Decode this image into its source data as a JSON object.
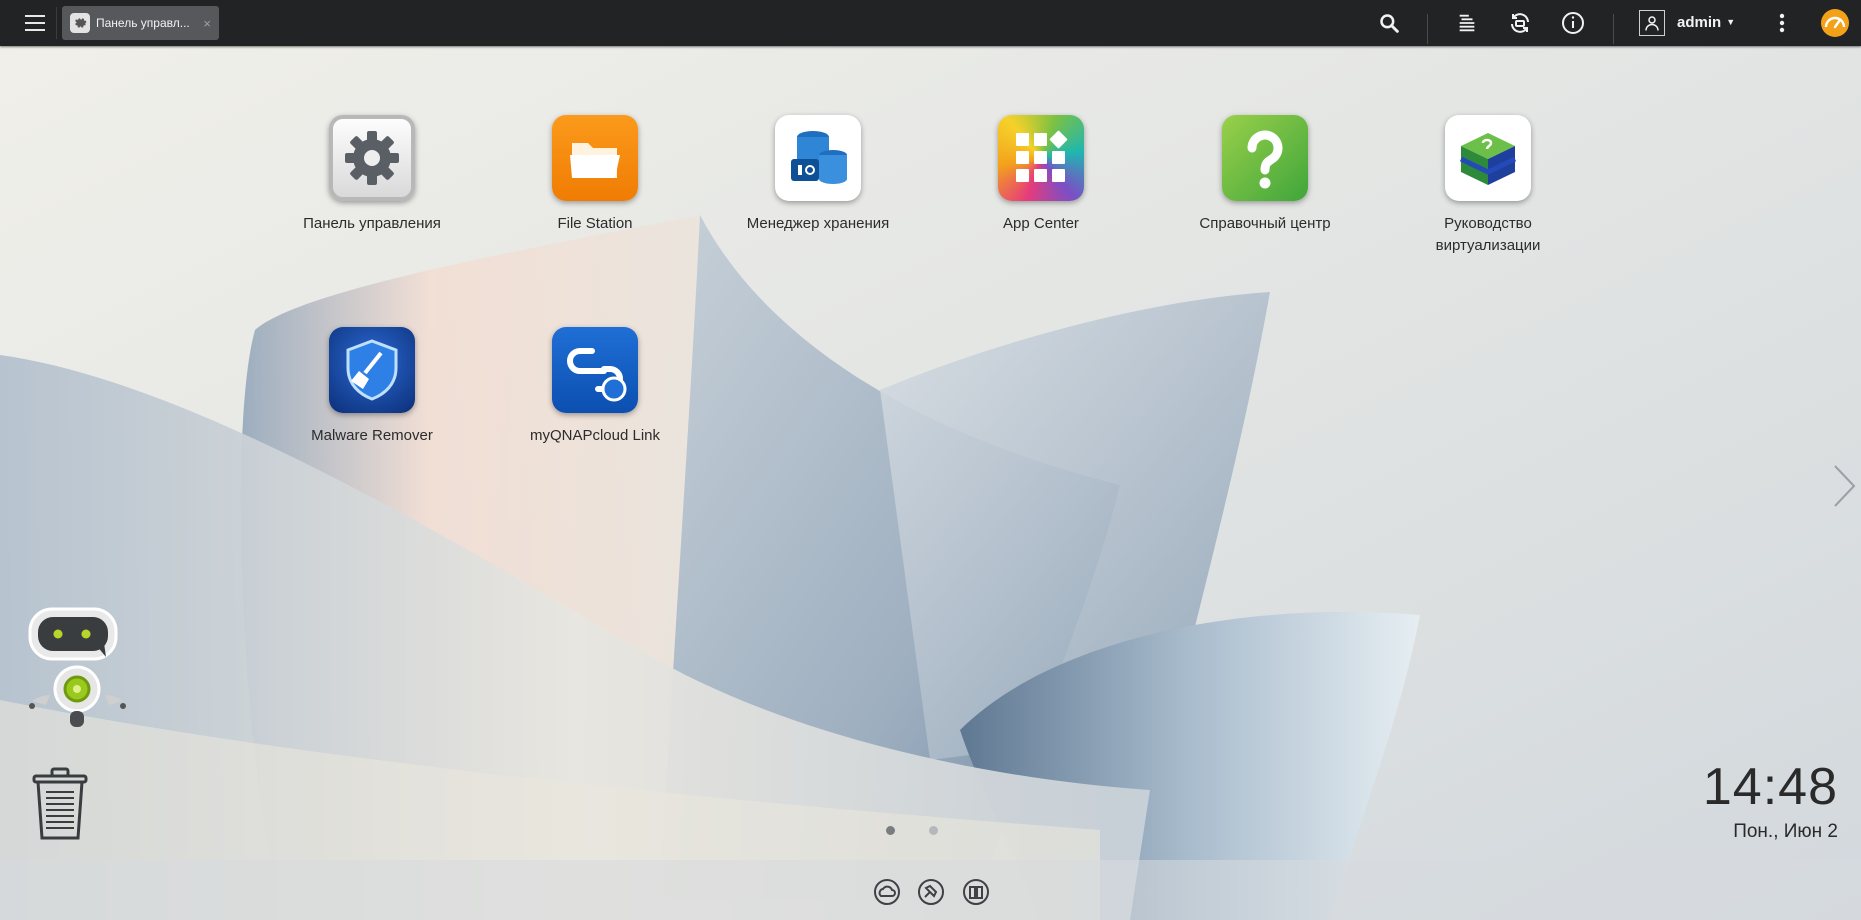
{
  "topbar": {
    "tab": {
      "label": "Панель управл...",
      "close": "×"
    },
    "user": {
      "name": "admin"
    }
  },
  "desktop": {
    "apps": [
      {
        "label": "Панель управления"
      },
      {
        "label": "File Station"
      },
      {
        "label": "Менеджер хранения"
      },
      {
        "label": "App Center"
      },
      {
        "label": "Справочный центр"
      },
      {
        "label": "Руководство виртуализации"
      },
      {
        "label": "Malware Remover"
      },
      {
        "label": "myQNAPcloud Link"
      }
    ]
  },
  "clock": {
    "time": "14:48",
    "date": "Пон., Июн 2"
  },
  "colors": {
    "topbar": "#222325",
    "accent": "#f4a11a"
  }
}
